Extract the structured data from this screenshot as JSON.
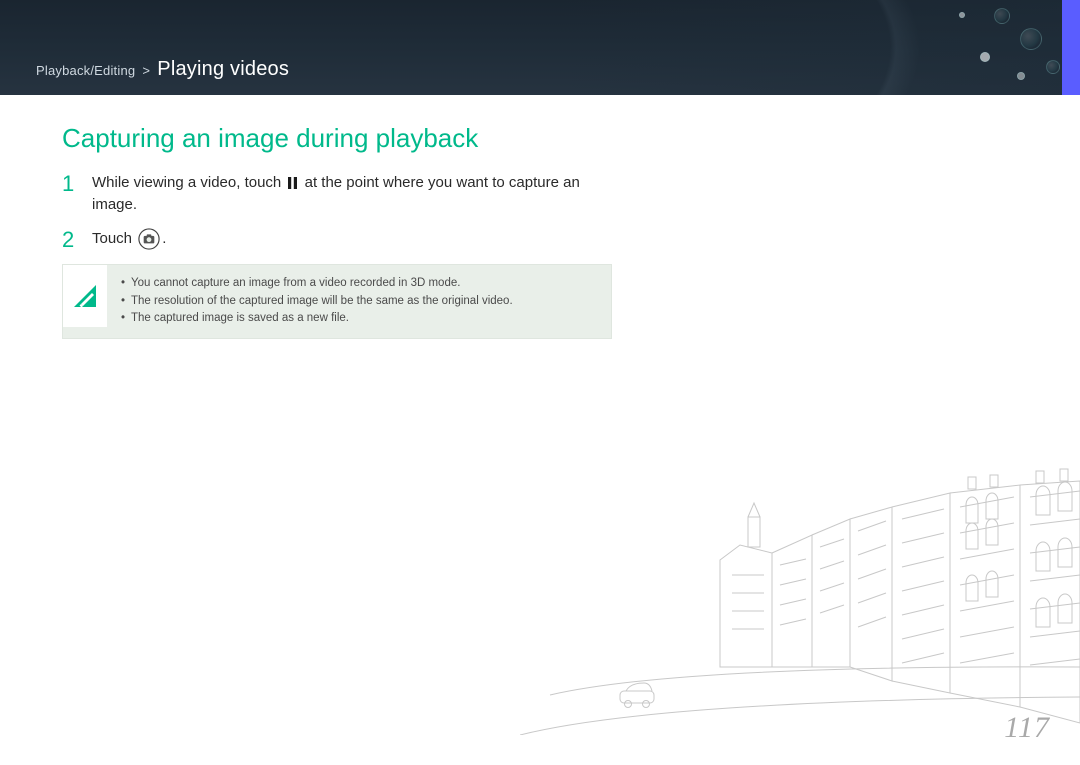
{
  "header": {
    "breadcrumb_parent": "Playback/Editing",
    "breadcrumb_sep": ">",
    "breadcrumb_current": "Playing videos"
  },
  "section": {
    "heading": "Capturing an image during playback"
  },
  "steps": [
    {
      "num": "1",
      "text_before_icon": "While viewing a video, touch ",
      "text_after_icon": " at the point where you want to capture an image."
    },
    {
      "num": "2",
      "text_before_icon": "Touch ",
      "text_after_icon": "."
    }
  ],
  "notes": [
    "You cannot capture an image from a video recorded in 3D mode.",
    "The resolution of the captured image will be the same as the original video.",
    "The captured image is saved as a new file."
  ],
  "page_number": "117"
}
